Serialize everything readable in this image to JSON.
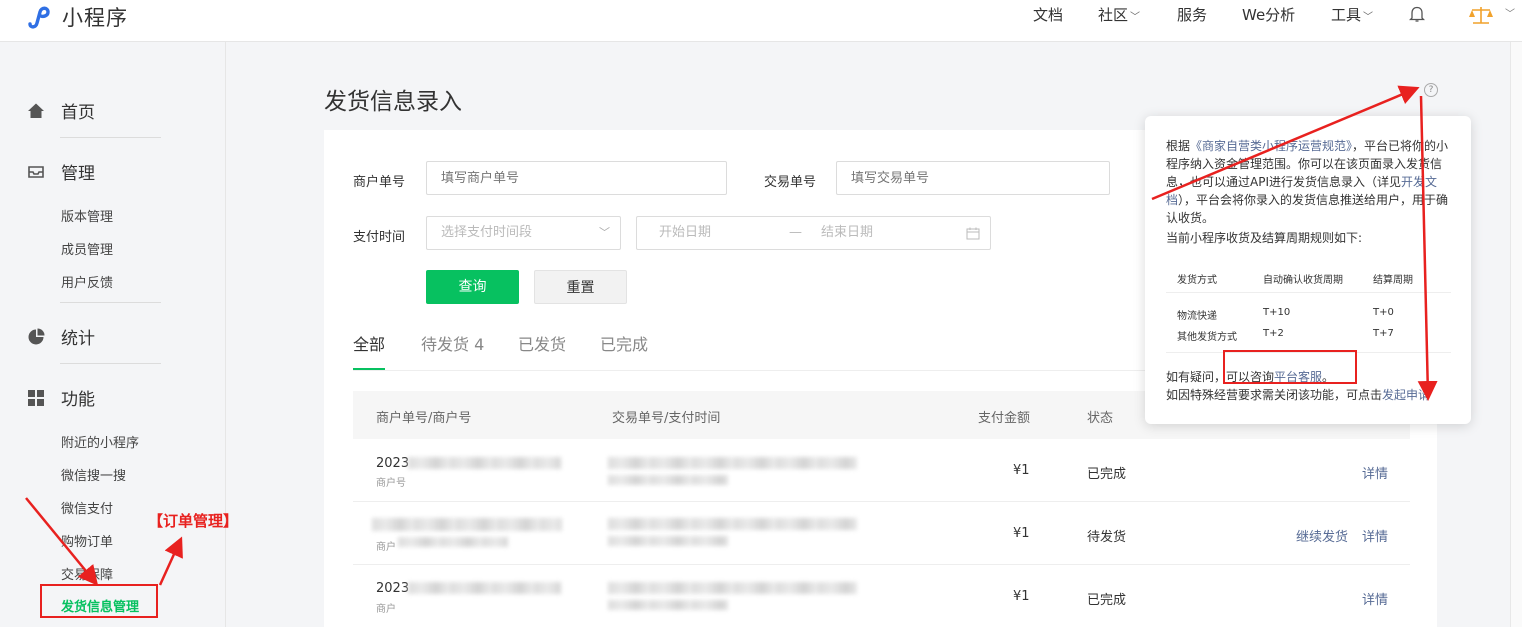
{
  "app": {
    "title": "小程序"
  },
  "topnav": {
    "items": [
      "文档",
      "社区",
      "服务",
      "We分析",
      "工具"
    ],
    "has_dropdown": [
      false,
      true,
      false,
      false,
      true
    ]
  },
  "sidebar": {
    "groups": [
      {
        "label": "首页",
        "icon": "home-icon"
      },
      {
        "label": "管理",
        "icon": "inbox-icon"
      },
      {
        "label": "统计",
        "icon": "pie-chart-icon"
      },
      {
        "label": "功能",
        "icon": "grid-icon"
      }
    ],
    "manage_items": [
      "版本管理",
      "成员管理",
      "用户反馈"
    ],
    "function_items": [
      "附近的小程序",
      "微信搜一搜",
      "微信支付",
      "购物订单",
      "交易保障",
      "发货信息管理"
    ],
    "active_item": "发货信息管理"
  },
  "page": {
    "title": "发货信息录入"
  },
  "filters": {
    "merchant_no_label": "商户单号",
    "merchant_no_placeholder": "填写商户单号",
    "trade_no_label": "交易单号",
    "trade_no_placeholder": "填写交易单号",
    "pay_time_label": "支付时间",
    "pay_time_placeholder": "选择支付时间段",
    "start_date_placeholder": "开始日期",
    "date_separator": "—",
    "end_date_placeholder": "结束日期",
    "query_button": "查询",
    "reset_button": "重置"
  },
  "tabs": [
    "全部",
    "待发货 4",
    "已发货",
    "已完成"
  ],
  "table": {
    "headers": [
      "商户单号/商户号",
      "交易单号/支付时间",
      "支付金额",
      "状态"
    ],
    "rows": [
      {
        "merchant_prefix": "2023",
        "merchant_sub": "商户号",
        "amount": "¥1",
        "status": "已完成",
        "actions": [
          "详情"
        ]
      },
      {
        "merchant_prefix": "",
        "merchant_sub": "商户",
        "amount": "¥1",
        "status": "待发货",
        "actions": [
          "继续发货",
          "详情"
        ]
      },
      {
        "merchant_prefix": "2023",
        "merchant_sub": "商户",
        "amount": "¥1",
        "status": "已完成",
        "actions": [
          "详情"
        ]
      }
    ]
  },
  "popover": {
    "intro_prefix": "根据",
    "intro_link": "《商家自营类小程序运营规范》",
    "intro_rest": "，平台已将你的小程序纳入资金管理范围。你可以在该页面录入发货信息，也可以通过API进行发货信息录入（详见",
    "doc_link": "开发文档",
    "intro_rest2": "），平台会将你录入的发货信息推送给用户，用于确认收货。",
    "rule_line": "当前小程序收货及结算周期规则如下:",
    "table_headers": [
      "发货方式",
      "自动确认收货周期",
      "结算周期"
    ],
    "table_rows": [
      [
        "物流快递",
        "T+10",
        "T+0"
      ],
      [
        "其他发货方式",
        "T+2",
        "T+7"
      ]
    ],
    "help_prefix": "如有疑问，",
    "help_mid": "可以咨询",
    "help_link": "平台客服",
    "help_end": "。",
    "close_text": "如因特殊经营要求需关闭该功能，可点击",
    "close_link": "发起申请"
  },
  "annotation": {
    "label": "【订单管理】",
    "color": "#e8211f"
  },
  "colors": {
    "accent": "#07c160",
    "link": "#576b95"
  }
}
